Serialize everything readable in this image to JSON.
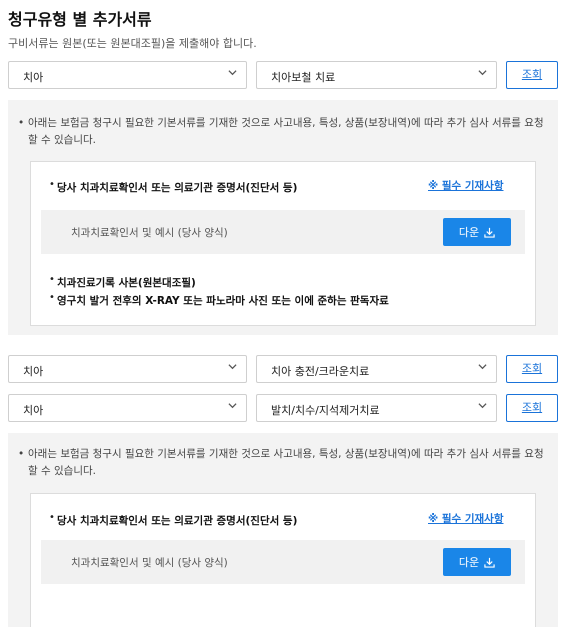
{
  "page": {
    "title": "청구유형 별 추가서류",
    "description": "구비서류는 원본(또는 원본대조필)을 제출해야 합니다."
  },
  "query_button_label": "조회",
  "query_rows": [
    {
      "category": "치아",
      "treatment": "치아보철 치료"
    },
    {
      "category": "치아",
      "treatment": "치아 충전/크라운치료"
    },
    {
      "category": "치아",
      "treatment": "발치/치수/지석제거치료"
    }
  ],
  "panels": [
    {
      "notice": "아래는 보험금 청구시 필요한 기본서류를 기재한 것으로 사고내용, 특성, 상품(보장내역)에 따라 추가 심사 서류를 요청할 수 있습니다.",
      "required_doc": "당사 치과치료확인서 또는 의료기관 증명서(진단서 등)",
      "required_link": "※ 필수 기재사항",
      "download_label": "치과치료확인서 및 예시 (당사 양식)",
      "download_button": "다운",
      "extra_docs": [
        "치과진료기록 사본(원본대조필)",
        "영구치 발거 전후의 X-RAY 또는 파노라마 사진 또는 이에 준하는 판독자료"
      ]
    },
    {
      "notice": "아래는 보험금 청구시 필요한 기본서류를 기재한 것으로 사고내용, 특성, 상품(보장내역)에 따라 추가 심사 서류를 요청할 수 있습니다.",
      "required_doc": "당사 치과치료확인서 또는 의료기관 증명서(진단서 등)",
      "required_link": "※ 필수 기재사항",
      "download_label": "치과치료확인서 및 예시 (당사 양식)",
      "download_button": "다운"
    }
  ],
  "colors": {
    "accent": "#1a73d9",
    "button_fill": "#1a86e8",
    "panel_bg": "#f3f3f3"
  }
}
